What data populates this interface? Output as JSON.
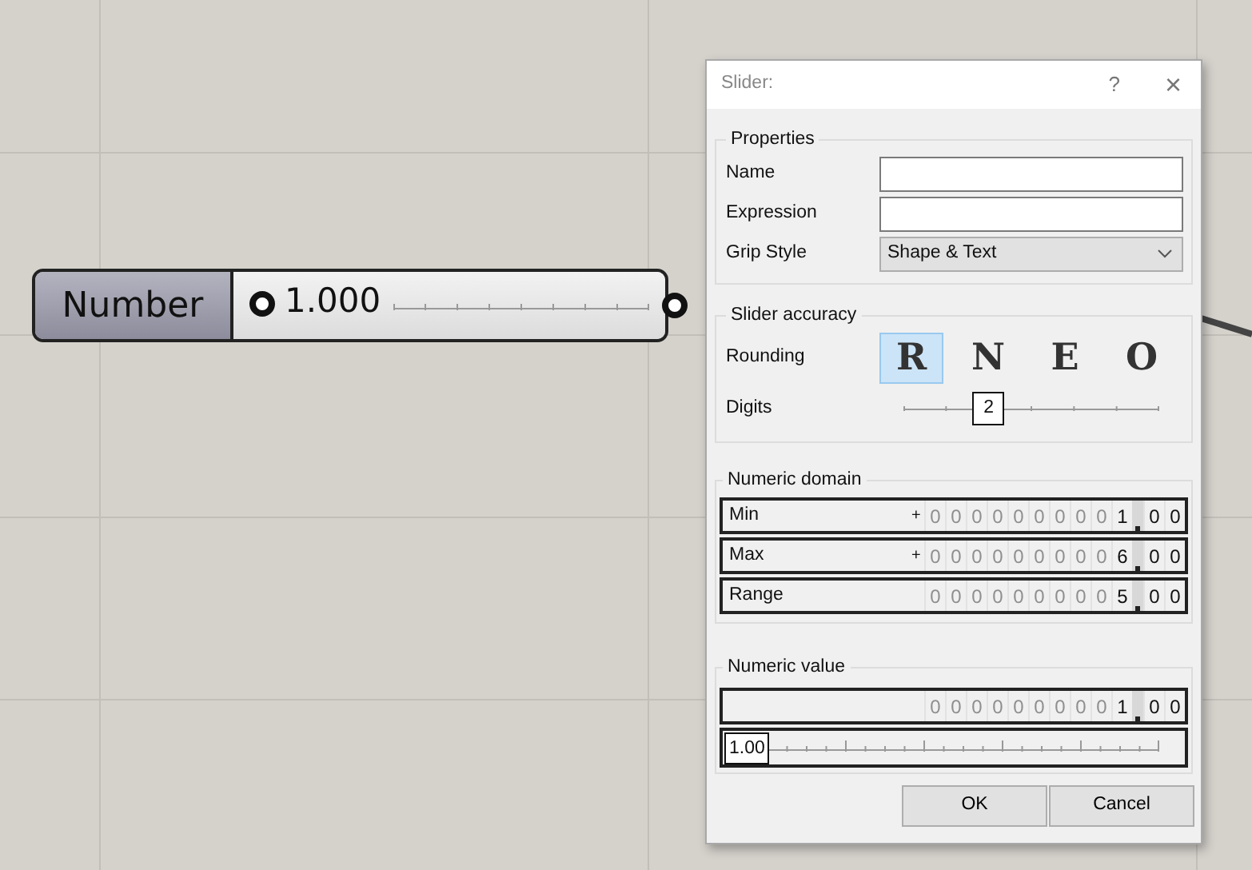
{
  "canvas": {
    "node": {
      "label": "Number",
      "value": "1.000",
      "level": 0
    }
  },
  "dialog": {
    "title": "Slider:",
    "help": "?",
    "close": "×",
    "properties": {
      "legend": "Properties",
      "fields": [
        {
          "label": "Name"
        },
        {
          "label": "Expression"
        }
      ],
      "grip_style": {
        "label": "Grip Style",
        "value": "Shape & Text"
      }
    },
    "accuracy": {
      "legend": "Slider accuracy",
      "rounding_label": "Rounding",
      "rounding_options": [
        {
          "label": "R",
          "selected": true
        },
        {
          "label": "N",
          "selected": false
        },
        {
          "label": "E",
          "selected": false
        },
        {
          "label": "O",
          "selected": false
        }
      ],
      "digits_label": "Digits",
      "digits": {
        "value": "2",
        "level": 0.333
      }
    },
    "domain": {
      "legend": "Numeric domain",
      "rows": [
        {
          "label": "Min",
          "sign": "+",
          "integer": [
            "0",
            "0",
            "0",
            "0",
            "0",
            "0",
            "0",
            "0",
            "0",
            "1"
          ],
          "decimals": [
            "0",
            "0"
          ]
        },
        {
          "label": "Max",
          "sign": "+",
          "integer": [
            "0",
            "0",
            "0",
            "0",
            "0",
            "0",
            "0",
            "0",
            "0",
            "6"
          ],
          "decimals": [
            "0",
            "0"
          ]
        },
        {
          "label": "Range",
          "integer": [
            "0",
            "0",
            "0",
            "0",
            "0",
            "0",
            "0",
            "0",
            "0",
            "5"
          ],
          "decimals": [
            "0",
            "0"
          ]
        }
      ]
    },
    "value": {
      "legend": "Numeric value",
      "integer": [
        "0",
        "0",
        "0",
        "0",
        "0",
        "0",
        "0",
        "0",
        "0",
        "1"
      ],
      "decimals": [
        "0",
        "0"
      ],
      "slider": {
        "value": "1.00",
        "level": 0
      }
    },
    "buttons": [
      "OK",
      "Cancel"
    ]
  }
}
